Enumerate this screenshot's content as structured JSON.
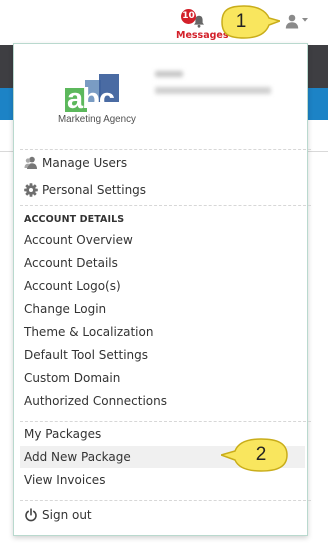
{
  "topbar": {
    "messages": {
      "count": "10",
      "label": "Messages",
      "icon": "bell-icon"
    },
    "user_icon": "user-icon",
    "caret_icon": "caret-down-icon"
  },
  "account_logo": {
    "letters": "abc",
    "tagline": "Marketing Agency"
  },
  "menu": {
    "manage_users": {
      "label": "Manage Users",
      "icon": "users-icon"
    },
    "personal_settings": {
      "label": "Personal Settings",
      "icon": "gear-icon"
    },
    "account_details_heading": "ACCOUNT DETAILS",
    "account_items": [
      "Account Overview",
      "Account Details",
      "Account Logo(s)",
      "Change Login",
      "Theme & Localization",
      "Default Tool Settings",
      "Custom Domain",
      "Authorized Connections"
    ],
    "package_items": [
      "My Packages",
      "Add New Package",
      "View Invoices"
    ],
    "sign_out": {
      "label": "Sign out",
      "icon": "power-icon"
    }
  },
  "annotations": [
    "1",
    "2"
  ],
  "colors": {
    "badge": "#d3202a",
    "callout": "#f9e65e",
    "callout_border": "#c9ad1a",
    "header_dark": "#3e3e42",
    "header_blue": "#1c83c6"
  }
}
